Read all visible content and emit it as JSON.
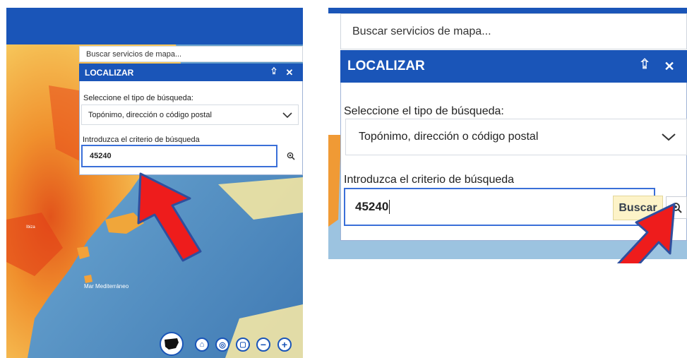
{
  "left_view": {
    "search_placeholder": "Buscar servicios de mapa...",
    "panel_title": "LOCALIZAR",
    "collapse_icon": "double-chevron-up-icon",
    "close_icon": "close-icon",
    "search_type_label": "Seleccione el tipo de búsqueda:",
    "search_type_value": "Topónimo, dirección o código postal",
    "criteria_label": "Introduzca el criterio de búsqueda",
    "criteria_value": "45240",
    "search_icon": "magnifier-icon",
    "map_labels": [
      "Ibiza",
      "Mar Mediterráneo"
    ],
    "map_controls": [
      "spain-map-icon",
      "home-icon",
      "locate-icon",
      "extent-icon",
      "zoom-out-icon",
      "zoom-in-icon"
    ]
  },
  "right_view": {
    "search_placeholder": "Buscar servicios de mapa...",
    "panel_title": "LOCALIZAR",
    "search_type_label": "Seleccione el tipo de búsqueda:",
    "search_type_value": "Topónimo, dirección o código postal",
    "criteria_label": "Introduzca el criterio de búsqueda",
    "criteria_value": "45240",
    "tooltip": "Buscar"
  },
  "colors": {
    "brand_blue": "#1a55b8",
    "arrow_red": "#ee1c1c",
    "arrow_outline": "#2f4f9e",
    "tooltip_bg": "#fdf3c8"
  }
}
